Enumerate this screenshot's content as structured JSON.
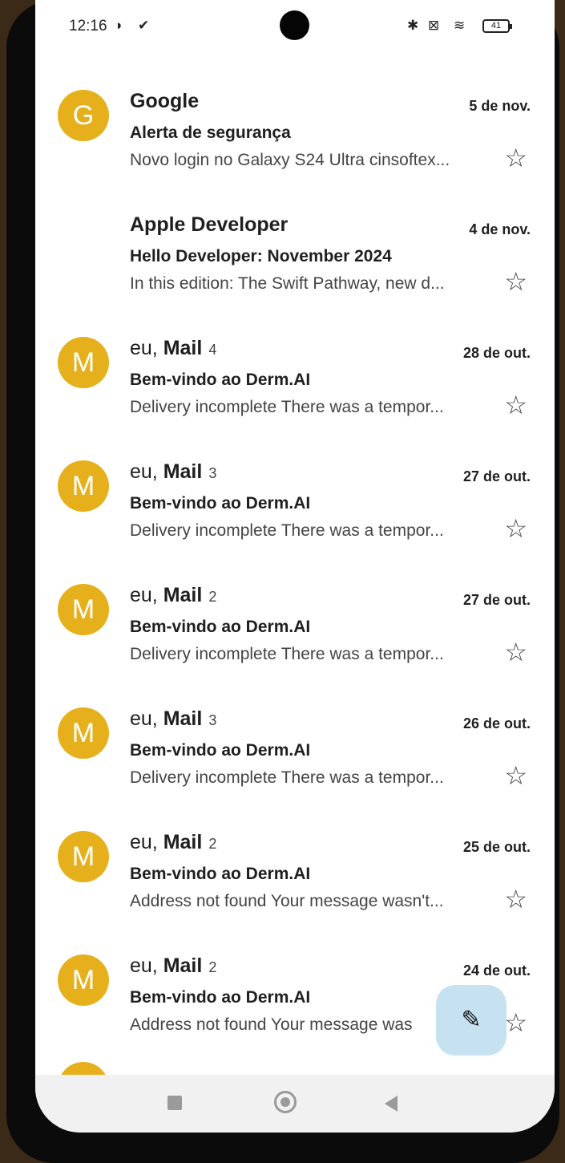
{
  "status_bar": {
    "time": "12:16",
    "battery": "41"
  },
  "emails": [
    {
      "avatar": "G",
      "sender_prefix": "",
      "sender": "Google",
      "count": "",
      "date": "5 de nov.",
      "subject": "Alerta de segurança",
      "snippet": "Novo login no Galaxy S24 Ultra cinsoftex..."
    },
    {
      "avatar": "",
      "sender_prefix": "",
      "sender": "Apple Developer",
      "count": "",
      "date": "4 de nov.",
      "subject": "Hello Developer: November 2024",
      "snippet": "In this edition: The Swift Pathway, new d..."
    },
    {
      "avatar": "M",
      "sender_prefix": "eu, ",
      "sender": "Mail",
      "count": "4",
      "date": "28 de out.",
      "subject": "Bem-vindo ao Derm.AI",
      "snippet": "Delivery incomplete There was a tempor..."
    },
    {
      "avatar": "M",
      "sender_prefix": "eu, ",
      "sender": "Mail",
      "count": "3",
      "date": "27 de out.",
      "subject": "Bem-vindo ao Derm.AI",
      "snippet": "Delivery incomplete There was a tempor..."
    },
    {
      "avatar": "M",
      "sender_prefix": "eu, ",
      "sender": "Mail",
      "count": "2",
      "date": "27 de out.",
      "subject": "Bem-vindo ao Derm.AI",
      "snippet": "Delivery incomplete There was a tempor..."
    },
    {
      "avatar": "M",
      "sender_prefix": "eu, ",
      "sender": "Mail",
      "count": "3",
      "date": "26 de out.",
      "subject": "Bem-vindo ao Derm.AI",
      "snippet": "Delivery incomplete There was a tempor..."
    },
    {
      "avatar": "M",
      "sender_prefix": "eu, ",
      "sender": "Mail",
      "count": "2",
      "date": "25 de out.",
      "subject": "Bem-vindo ao Derm.AI",
      "snippet": "Address not found Your message wasn't..."
    },
    {
      "avatar": "M",
      "sender_prefix": "eu, ",
      "sender": "Mail",
      "count": "2",
      "date": "24 de out.",
      "subject": "Bem-vindo ao Derm.AI",
      "snippet": "Address not found Your message was"
    }
  ],
  "icons": {
    "star": "☆",
    "compose": "✎",
    "apple": ""
  },
  "colors": {
    "avatar": "#e6b01d",
    "fab": "#c6e2f0"
  }
}
